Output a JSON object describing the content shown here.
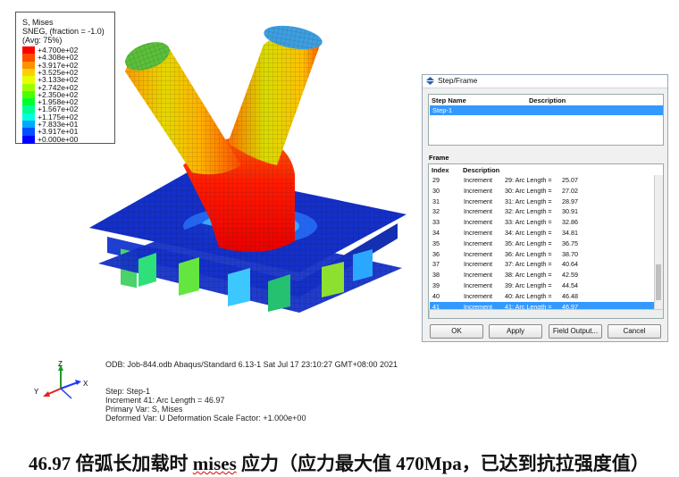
{
  "legend": {
    "line1": "S, Mises",
    "line2": "SNEG, (fraction = -1.0)",
    "line3": "(Avg: 75%)",
    "entries": [
      {
        "value": "+4.700e+02",
        "color": "#ff0000"
      },
      {
        "value": "+4.308e+02",
        "color": "#ff4a00"
      },
      {
        "value": "+3.917e+02",
        "color": "#ff9100"
      },
      {
        "value": "+3.525e+02",
        "color": "#ffd000"
      },
      {
        "value": "+3.133e+02",
        "color": "#e4ff00"
      },
      {
        "value": "+2.742e+02",
        "color": "#9bff00"
      },
      {
        "value": "+2.350e+02",
        "color": "#4dff00"
      },
      {
        "value": "+1.958e+02",
        "color": "#00ff30"
      },
      {
        "value": "+1.567e+02",
        "color": "#00ff90"
      },
      {
        "value": "+1.175e+02",
        "color": "#00ffe0"
      },
      {
        "value": "+7.833e+01",
        "color": "#00a8ff"
      },
      {
        "value": "+3.917e+01",
        "color": "#0050ff"
      },
      {
        "value": "+0.000e+00",
        "color": "#0000ff"
      }
    ]
  },
  "dialog": {
    "title": "Step/Frame",
    "step_col_name": "Step Name",
    "step_col_desc": "Description",
    "step_selected": "Step-1",
    "frame_label": "Frame",
    "frame_col_index": "Index",
    "frame_col_desc": "Description",
    "frames": [
      {
        "index": "29",
        "type": "Increment",
        "desc": "29: Arc Length =",
        "value": "25.07"
      },
      {
        "index": "30",
        "type": "Increment",
        "desc": "30: Arc Length =",
        "value": "27.02"
      },
      {
        "index": "31",
        "type": "Increment",
        "desc": "31: Arc Length =",
        "value": "28.97"
      },
      {
        "index": "32",
        "type": "Increment",
        "desc": "32: Arc Length =",
        "value": "30.91"
      },
      {
        "index": "33",
        "type": "Increment",
        "desc": "33: Arc Length =",
        "value": "32.86"
      },
      {
        "index": "34",
        "type": "Increment",
        "desc": "34: Arc Length =",
        "value": "34.81"
      },
      {
        "index": "35",
        "type": "Increment",
        "desc": "35: Arc Length =",
        "value": "36.75"
      },
      {
        "index": "36",
        "type": "Increment",
        "desc": "36: Arc Length =",
        "value": "38.70"
      },
      {
        "index": "37",
        "type": "Increment",
        "desc": "37: Arc Length =",
        "value": "40.64"
      },
      {
        "index": "38",
        "type": "Increment",
        "desc": "38: Arc Length =",
        "value": "42.59"
      },
      {
        "index": "39",
        "type": "Increment",
        "desc": "39: Arc Length =",
        "value": "44.54"
      },
      {
        "index": "40",
        "type": "Increment",
        "desc": "40: Arc Length =",
        "value": "46.48"
      },
      {
        "index": "41",
        "type": "Increment",
        "desc": "41: Arc Length =",
        "value": "46.97"
      }
    ],
    "buttons": {
      "ok": "OK",
      "apply": "Apply",
      "field_output": "Field Output...",
      "cancel": "Cancel"
    }
  },
  "info": {
    "odb_line": "ODB: Job-844.odb    Abaqus/Standard 6.13-1    Sat Jul 17 23:10:27 GMT+08:00 2021",
    "step_line": "Step: Step-1",
    "increment_line": "Increment      41: Arc Length =      46.97",
    "primary_var": "Primary Var: S, Mises",
    "deformed_var": "Deformed Var: U   Deformation Scale Factor: +1.000e+00"
  },
  "triad": {
    "x": "X",
    "y": "Y",
    "z": "Z"
  },
  "caption": {
    "part1": "46.97 倍弧长加载时 ",
    "part2": "mises",
    "part3": " 应力（应力最大值 470Mpa，已达到抗拉强度值）"
  }
}
